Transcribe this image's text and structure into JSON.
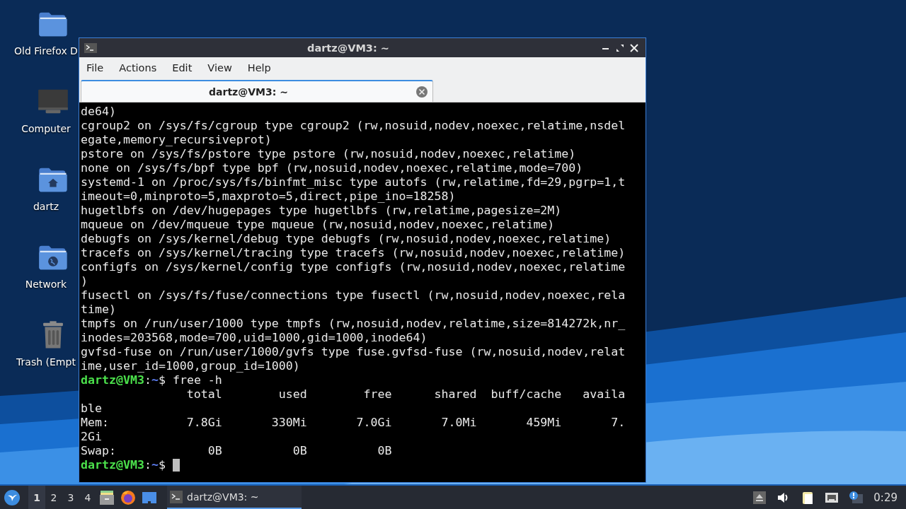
{
  "desktop": {
    "icons": [
      {
        "kind": "folder",
        "label": "Old Firefox D"
      },
      {
        "kind": "computer",
        "label": "Computer"
      },
      {
        "kind": "home",
        "label": "dartz"
      },
      {
        "kind": "network",
        "label": "Network"
      },
      {
        "kind": "trash",
        "label": "Trash (Empt"
      }
    ]
  },
  "window": {
    "title": "dartz@VM3: ~",
    "menu": [
      "File",
      "Actions",
      "Edit",
      "View",
      "Help"
    ],
    "tabs": [
      {
        "label": "dartz@VM3: ~",
        "selected": true
      }
    ],
    "terminal": {
      "lines": [
        {
          "kind": "output",
          "text": "de64)"
        },
        {
          "kind": "output",
          "text": "cgroup2 on /sys/fs/cgroup type cgroup2 (rw,nosuid,nodev,noexec,relatime,nsdel"
        },
        {
          "kind": "output",
          "text": "egate,memory_recursiveprot)"
        },
        {
          "kind": "output",
          "text": "pstore on /sys/fs/pstore type pstore (rw,nosuid,nodev,noexec,relatime)"
        },
        {
          "kind": "output",
          "text": "none on /sys/fs/bpf type bpf (rw,nosuid,nodev,noexec,relatime,mode=700)"
        },
        {
          "kind": "output",
          "text": "systemd-1 on /proc/sys/fs/binfmt_misc type autofs (rw,relatime,fd=29,pgrp=1,t"
        },
        {
          "kind": "output",
          "text": "imeout=0,minproto=5,maxproto=5,direct,pipe_ino=18258)"
        },
        {
          "kind": "output",
          "text": "hugetlbfs on /dev/hugepages type hugetlbfs (rw,relatime,pagesize=2M)"
        },
        {
          "kind": "output",
          "text": "mqueue on /dev/mqueue type mqueue (rw,nosuid,nodev,noexec,relatime)"
        },
        {
          "kind": "output",
          "text": "debugfs on /sys/kernel/debug type debugfs (rw,nosuid,nodev,noexec,relatime)"
        },
        {
          "kind": "output",
          "text": "tracefs on /sys/kernel/tracing type tracefs (rw,nosuid,nodev,noexec,relatime)"
        },
        {
          "kind": "output",
          "text": "configfs on /sys/kernel/config type configfs (rw,nosuid,nodev,noexec,relatime"
        },
        {
          "kind": "output",
          "text": ")"
        },
        {
          "kind": "output",
          "text": "fusectl on /sys/fs/fuse/connections type fusectl (rw,nosuid,nodev,noexec,rela"
        },
        {
          "kind": "output",
          "text": "time)"
        },
        {
          "kind": "output",
          "text": "tmpfs on /run/user/1000 type tmpfs (rw,nosuid,nodev,relatime,size=814272k,nr_"
        },
        {
          "kind": "output",
          "text": "inodes=203568,mode=700,uid=1000,gid=1000,inode64)"
        },
        {
          "kind": "output",
          "text": "gvfsd-fuse on /run/user/1000/gvfs type fuse.gvfsd-fuse (rw,nosuid,nodev,relat"
        },
        {
          "kind": "output",
          "text": "ime,user_id=1000,group_id=1000)"
        },
        {
          "kind": "prompt",
          "user": "dartz@VM3",
          "sep": ":",
          "path": "~",
          "symbol": "$",
          "command": "free -h",
          "cursor": false
        },
        {
          "kind": "output",
          "text": "               total        used        free      shared  buff/cache   availa"
        },
        {
          "kind": "output",
          "text": "ble"
        },
        {
          "kind": "output",
          "text": "Mem:           7.8Gi       330Mi       7.0Gi       7.0Mi       459Mi       7."
        },
        {
          "kind": "output",
          "text": "2Gi"
        },
        {
          "kind": "output",
          "text": "Swap:             0B          0B          0B"
        },
        {
          "kind": "prompt",
          "user": "dartz@VM3",
          "sep": ":",
          "path": "~",
          "symbol": "$",
          "cursor": true
        }
      ]
    }
  },
  "taskbar": {
    "workspaces": [
      {
        "label": "1",
        "selected": true
      },
      {
        "label": "2",
        "selected": false
      },
      {
        "label": "3",
        "selected": false
      },
      {
        "label": "4",
        "selected": false
      }
    ],
    "tasks": [
      {
        "label": "dartz@VM3: ~",
        "selected": true
      }
    ],
    "clock": "0:29"
  }
}
